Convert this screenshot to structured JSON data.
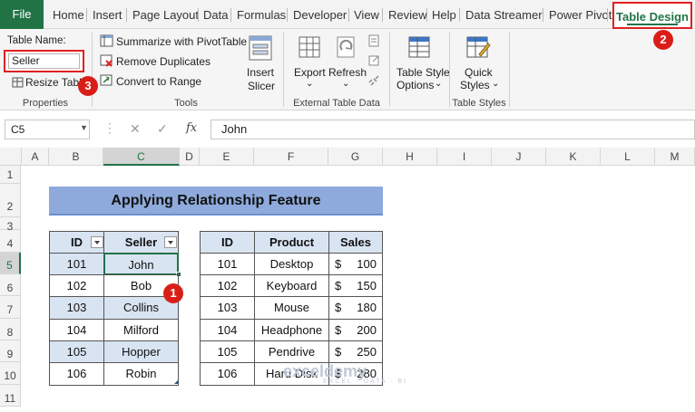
{
  "tabs": {
    "file": "File",
    "items": [
      "Home",
      "Insert",
      "Page Layout",
      "Data",
      "Formulas",
      "Developer",
      "View",
      "Review",
      "Help",
      "Data Streamer",
      "Power Pivot"
    ],
    "active": "Table Design"
  },
  "ribbon": {
    "properties": {
      "table_name_label": "Table Name:",
      "table_name_value": "Seller",
      "resize_label": "Resize Table",
      "group_label": "Properties"
    },
    "tools": {
      "summarize": "Summarize with PivotTable",
      "remove_duplicates": "Remove Duplicates",
      "convert": "Convert to Range",
      "insert_slicer_1": "Insert",
      "insert_slicer_2": "Slicer",
      "group_label": "Tools"
    },
    "external": {
      "export": "Export",
      "refresh": "Refresh",
      "group_label": "External Table Data"
    },
    "style_options": {
      "line1": "Table Style",
      "line2": "Options"
    },
    "styles": {
      "line1": "Quick",
      "line2": "Styles",
      "group_label": "Table Styles"
    }
  },
  "formula_bar": {
    "name_box": "C5",
    "fx": "fx",
    "value": "John"
  },
  "columns": [
    "A",
    "B",
    "C",
    "D",
    "E",
    "F",
    "G",
    "H",
    "I",
    "J",
    "K",
    "L",
    "M"
  ],
  "rows": [
    "1",
    "2",
    "3",
    "4",
    "5",
    "6",
    "7",
    "8",
    "9",
    "10",
    "11"
  ],
  "sheet": {
    "title": "Applying Relationship Feature",
    "table1": {
      "headers": [
        "ID",
        "Seller"
      ],
      "rows": [
        [
          "101",
          "John"
        ],
        [
          "102",
          "Bob"
        ],
        [
          "103",
          "Collins"
        ],
        [
          "104",
          "Milford"
        ],
        [
          "105",
          "Hopper"
        ],
        [
          "106",
          "Robin"
        ]
      ]
    },
    "table2": {
      "headers": [
        "ID",
        "Product",
        "Sales"
      ],
      "currency": "$",
      "rows": [
        [
          "101",
          "Desktop",
          "100"
        ],
        [
          "102",
          "Keyboard",
          "150"
        ],
        [
          "103",
          "Mouse",
          "180"
        ],
        [
          "104",
          "Headphone",
          "200"
        ],
        [
          "105",
          "Pendrive",
          "250"
        ],
        [
          "106",
          "Hard Disk",
          "280"
        ]
      ]
    }
  },
  "badges": [
    "1",
    "2",
    "3"
  ],
  "watermark": {
    "main": "exceldemy",
    "sub": "EXCEL · DATA · BI"
  },
  "colors": {
    "accent": "#217346",
    "badge": "#d91e18",
    "title_fill": "#8eaadc",
    "header_fill": "#d9e4f2"
  }
}
